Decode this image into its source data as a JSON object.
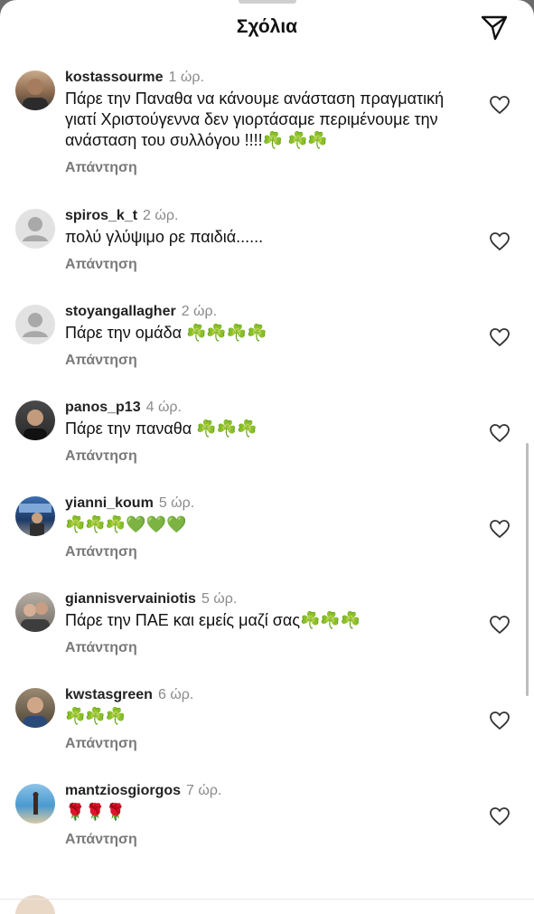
{
  "header": {
    "title": "Σχόλια"
  },
  "icons": {
    "send": "paper-plane-icon",
    "like": "heart-outline-icon",
    "default_avatar": "person-icon"
  },
  "colors": {
    "accent_green": "#3fa33a",
    "heart_green": "#2db82d",
    "rose_red": "#c8161b"
  },
  "comments": [
    {
      "user": "kostassourme",
      "time": "1 ώρ.",
      "text": "Πάρε την Παναθα να κάνουμε ανάσταση πραγματική γιατί Χριστούγεννα δεν γιορτάσαμε περιμένουμε την ανάσταση του συλλόγου !!!!☘️ ☘️☘️",
      "reply": "Απάντηση"
    },
    {
      "user": "spiros_k_t",
      "time": "2 ώρ.",
      "text": "πολύ γλύψιμο ρε παιδιά......",
      "reply": "Απάντηση"
    },
    {
      "user": "stoyangallagher",
      "time": "2 ώρ.",
      "text": "Πάρε την ομάδα ☘️☘️☘️☘️",
      "reply": "Απάντηση"
    },
    {
      "user": "panos_p13",
      "time": "4 ώρ.",
      "text": "Πάρε την παναθα ☘️☘️☘️",
      "reply": "Απάντηση"
    },
    {
      "user": "yianni_koum",
      "time": "5 ώρ.",
      "text": "☘️☘️☘️💚💚💚",
      "reply": "Απάντηση"
    },
    {
      "user": "giannisvervainiotis",
      "time": "5 ώρ.",
      "text": "Πάρε την ΠΑΕ και εμείς μαζί σας☘️☘️☘️",
      "reply": "Απάντηση"
    },
    {
      "user": "kwstasgreen",
      "time": "6 ώρ.",
      "text": "☘️☘️☘️",
      "reply": "Απάντηση"
    },
    {
      "user": "mantziosgiorgos",
      "time": "7 ώρ.",
      "text": "🌹🌹🌹",
      "reply": "Απάντηση"
    }
  ]
}
